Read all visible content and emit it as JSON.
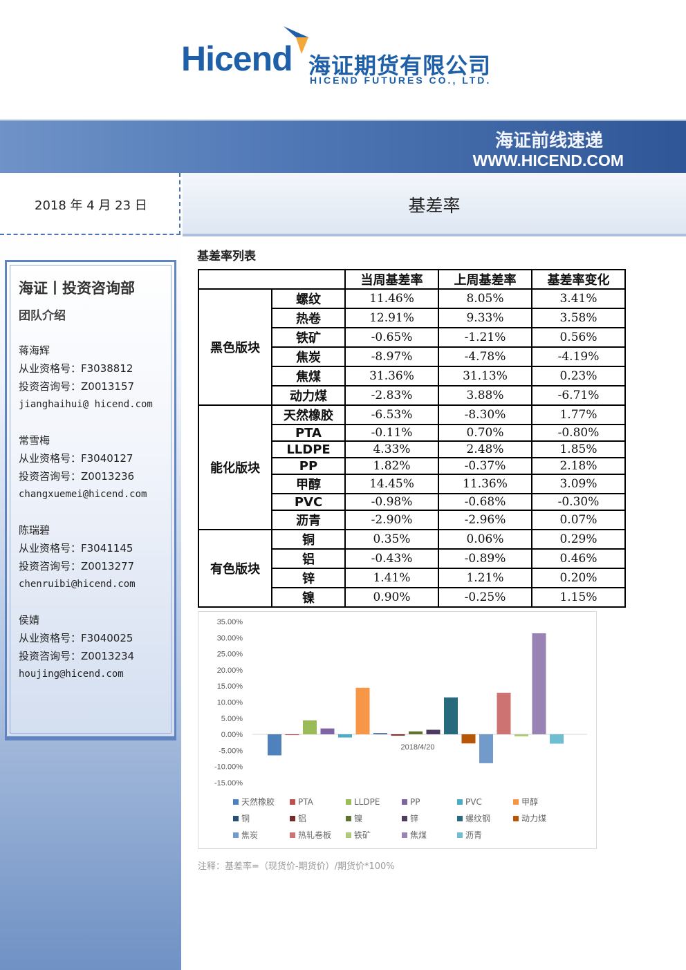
{
  "header": {
    "logo_word": "Hicend",
    "logo_cn": "海证期货有限公司",
    "logo_en": "HICEND  FUTURES  CO.,  LTD."
  },
  "banner": {
    "title": "海证前线速递",
    "url": "WWW.HICEND.COM"
  },
  "report": {
    "date": "2018 年 4 月 23 日",
    "title": "基差率"
  },
  "sidebar": {
    "dept": "海证丨投资咨询部",
    "team_intro": "团队介绍",
    "members": [
      {
        "name": "蒋海辉",
        "license": "从业资格号：F3038812",
        "consult": "投资咨询号：Z0013157",
        "email": "jianghaihui@ hicend.com"
      },
      {
        "name": "常雪梅",
        "license": "从业资格号：F3040127",
        "consult": "投资咨询号：Z0013236",
        "email": "changxuemei@hicend.com"
      },
      {
        "name": "陈瑞碧",
        "license": "从业资格号：F3041145",
        "consult": "投资咨询号：Z0013277",
        "email": "chenruibi@hicend.com"
      },
      {
        "name": "侯婧",
        "license": "从业资格号：F3040025",
        "consult": "投资咨询号：Z0013234",
        "email": "houjing@hicend.com"
      }
    ]
  },
  "table": {
    "title": "基差率列表",
    "headers": [
      "当周基差率",
      "上周基差率",
      "基差率变化"
    ],
    "sectors": [
      {
        "name": "黑色版块",
        "rows": [
          [
            "螺纹",
            "11.46%",
            "8.05%",
            "3.41%"
          ],
          [
            "热卷",
            "12.91%",
            "9.33%",
            "3.58%"
          ],
          [
            "铁矿",
            "-0.65%",
            "-1.21%",
            "0.56%"
          ],
          [
            "焦炭",
            "-8.97%",
            "-4.78%",
            "-4.19%"
          ],
          [
            "焦煤",
            "31.36%",
            "31.13%",
            "0.23%"
          ],
          [
            "动力煤",
            "-2.83%",
            "3.88%",
            "-6.71%"
          ]
        ]
      },
      {
        "name": "能化版块",
        "rows": [
          [
            "天然橡胶",
            "-6.53%",
            "-8.30%",
            "1.77%"
          ],
          [
            "PTA",
            "-0.11%",
            "0.70%",
            "-0.80%"
          ],
          [
            "LLDPE",
            "4.33%",
            "2.48%",
            "1.85%"
          ],
          [
            "PP",
            "1.82%",
            "-0.37%",
            "2.18%"
          ],
          [
            "甲醇",
            "14.45%",
            "11.36%",
            "3.09%"
          ],
          [
            "PVC",
            "-0.98%",
            "-0.68%",
            "-0.30%"
          ],
          [
            "沥青",
            "-2.90%",
            "-2.96%",
            "0.07%"
          ]
        ]
      },
      {
        "name": "有色版块",
        "rows": [
          [
            "铜",
            "0.35%",
            "0.06%",
            "0.29%"
          ],
          [
            "铝",
            "-0.43%",
            "-0.89%",
            "0.46%"
          ],
          [
            "锌",
            "1.41%",
            "1.21%",
            "0.20%"
          ],
          [
            "镍",
            "0.90%",
            "-0.25%",
            "1.15%"
          ]
        ]
      }
    ]
  },
  "chart_data": {
    "type": "bar",
    "category": "2018/4/20",
    "yticks": [
      "35.00%",
      "30.00%",
      "25.00%",
      "20.00%",
      "15.00%",
      "10.00%",
      "5.00%",
      "0.00%",
      "-5.00%",
      "-10.00%",
      "-15.00%"
    ],
    "ylim": [
      -15,
      35
    ],
    "series": [
      {
        "name": "天然橡胶",
        "value": -6.53,
        "color": "#4f81bd"
      },
      {
        "name": "PTA",
        "value": -0.11,
        "color": "#c0504d"
      },
      {
        "name": "LLDPE",
        "value": 4.33,
        "color": "#9bbb59"
      },
      {
        "name": "PP",
        "value": 1.82,
        "color": "#8064a2"
      },
      {
        "name": "PVC",
        "value": -0.98,
        "color": "#4bacc6"
      },
      {
        "name": "甲醇",
        "value": 14.45,
        "color": "#f79646"
      },
      {
        "name": "铜",
        "value": 0.35,
        "color": "#2c4d75"
      },
      {
        "name": "铝",
        "value": -0.43,
        "color": "#772c2a"
      },
      {
        "name": "镍",
        "value": 0.9,
        "color": "#5f7530"
      },
      {
        "name": "锌",
        "value": 1.41,
        "color": "#4d3b62"
      },
      {
        "name": "螺纹钢",
        "value": 11.46,
        "color": "#276a7c"
      },
      {
        "name": "动力煤",
        "value": -2.83,
        "color": "#b65708"
      },
      {
        "name": "焦炭",
        "value": -8.97,
        "color": "#729aca"
      },
      {
        "name": "热轧卷板",
        "value": 12.91,
        "color": "#cd7371"
      },
      {
        "name": "铁矿",
        "value": -0.65,
        "color": "#afc97a"
      },
      {
        "name": "焦煤",
        "value": 31.36,
        "color": "#9983b5"
      },
      {
        "name": "沥青",
        "value": -2.9,
        "color": "#6fbdd1"
      }
    ]
  },
  "note": "注释：基差率=（现货价-期货价）/期货价*100%"
}
